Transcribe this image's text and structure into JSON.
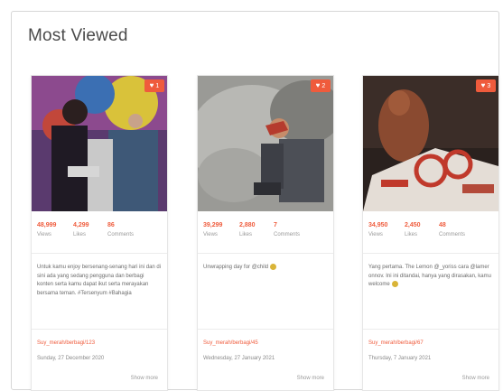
{
  "header": {
    "title": "Most Viewed"
  },
  "colors": {
    "accent": "#ef5b3c",
    "text_muted": "#9a9a9a"
  },
  "cards": [
    {
      "likes_badge": "1",
      "stats": [
        {
          "value": "48,999",
          "label": "Views"
        },
        {
          "value": "4,299",
          "label": "Likes"
        },
        {
          "value": "86",
          "label": "Comments"
        }
      ],
      "caption": "Untuk kamu enjoy bersenang-senang hari ini dan di sini ada yang sedang pengguna dan berbagi konten serta kamu dapat ikut serta merayakan bersama teman. #Tersenyum #Bahagia",
      "user": "Suy_merah/berbagi/123",
      "date": "Sunday, 27 December 2020",
      "show_more": "Show more"
    },
    {
      "likes_badge": "2",
      "stats": [
        {
          "value": "39,299",
          "label": "Views"
        },
        {
          "value": "2,880",
          "label": "Likes"
        },
        {
          "value": "7",
          "label": "Comments"
        }
      ],
      "caption": "Unwrapping day for @child",
      "user": "Suy_merah/berbagi/45",
      "date": "Wednesday, 27 January 2021",
      "show_more": "Show more"
    },
    {
      "likes_badge": "3",
      "stats": [
        {
          "value": "34,950",
          "label": "Views"
        },
        {
          "value": "2,450",
          "label": "Likes"
        },
        {
          "value": "48",
          "label": "Comments"
        }
      ],
      "caption": "Yang pertama. The Lemon @_yoriss cara @lamer onnov. Ini ini ditandai, hanya yang dirasakan, kamu welcome",
      "user": "Suy_merah/berbagi/67",
      "date": "Thursday, 7 January 2021",
      "show_more": "Show more"
    }
  ]
}
